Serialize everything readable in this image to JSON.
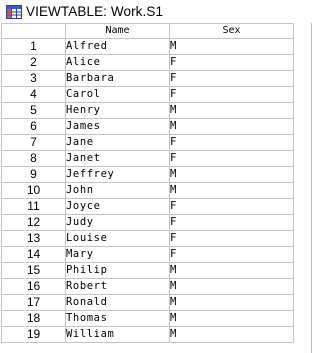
{
  "window": {
    "title": "VIEWTABLE: Work.S1",
    "icon": "viewtable-grid-icon"
  },
  "table": {
    "columns": [
      "Name",
      "Sex"
    ],
    "rows": [
      {
        "num": "1",
        "name": "Alfred",
        "sex": "M"
      },
      {
        "num": "2",
        "name": "Alice",
        "sex": "F"
      },
      {
        "num": "3",
        "name": "Barbara",
        "sex": "F"
      },
      {
        "num": "4",
        "name": "Carol",
        "sex": "F"
      },
      {
        "num": "5",
        "name": "Henry",
        "sex": "M"
      },
      {
        "num": "6",
        "name": "James",
        "sex": "M"
      },
      {
        "num": "7",
        "name": "Jane",
        "sex": "F"
      },
      {
        "num": "8",
        "name": "Janet",
        "sex": "F"
      },
      {
        "num": "9",
        "name": "Jeffrey",
        "sex": "M"
      },
      {
        "num": "10",
        "name": "John",
        "sex": "M"
      },
      {
        "num": "11",
        "name": "Joyce",
        "sex": "F"
      },
      {
        "num": "12",
        "name": "Judy",
        "sex": "F"
      },
      {
        "num": "13",
        "name": "Louise",
        "sex": "F"
      },
      {
        "num": "14",
        "name": "Mary",
        "sex": "F"
      },
      {
        "num": "15",
        "name": "Philip",
        "sex": "M"
      },
      {
        "num": "16",
        "name": "Robert",
        "sex": "M"
      },
      {
        "num": "17",
        "name": "Ronald",
        "sex": "M"
      },
      {
        "num": "18",
        "name": "Thomas",
        "sex": "M"
      },
      {
        "num": "19",
        "name": "William",
        "sex": "M"
      }
    ]
  }
}
